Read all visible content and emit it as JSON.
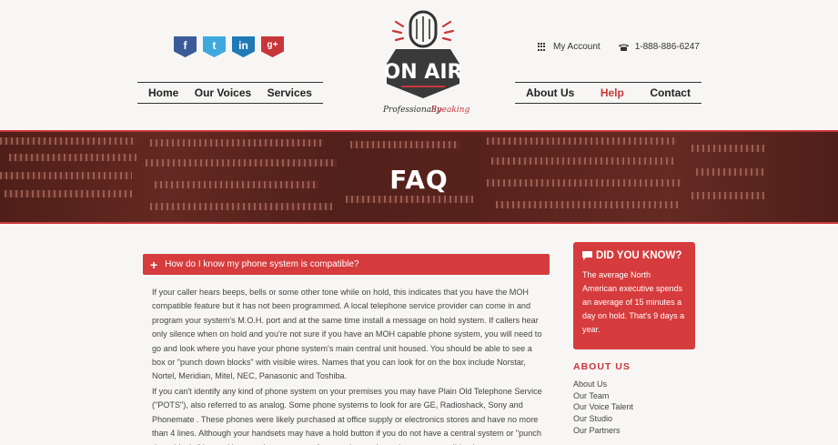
{
  "social": [
    {
      "name": "facebook",
      "glyph": "f"
    },
    {
      "name": "twitter",
      "glyph": "t"
    },
    {
      "name": "linkedin",
      "glyph": "in"
    },
    {
      "name": "google-plus",
      "glyph": "g+"
    }
  ],
  "nav_left": [
    "Home",
    "Our Voices",
    "Services"
  ],
  "nav_right": [
    "About Us",
    "Help",
    "Contact"
  ],
  "active_nav": "Help",
  "header": {
    "account_label": "My Account",
    "phone": "1-888-886-6247"
  },
  "logo": {
    "main": "ON AIR",
    "tagline_1": "Professionally",
    "tagline_2": "Speaking"
  },
  "banner": {
    "title": "FAQ"
  },
  "faq": {
    "question": "How do I know my phone system is compatible?",
    "answer_1": "If your caller hears beeps, bells or some other tone while on hold, this indicates that you have the MOH compatible feature but it has not been programmed. A local telephone service provider can come in and program your system's M.O.H. port and at the same time install a message on hold system. If callers hear only silence when on hold and you're not sure if you have an MOH capable phone system, you will need to go and look where you have your phone system's main central unit housed. You should be able to see a box or \"punch down blocks\" with visible wires. Names that you can look for on the box include Norstar, Nortel, Meridian, Mitel, NEC, Panasonic and Toshiba.",
    "answer_2": "If you can't identify any kind of phone system on your premises you may have Plain Old Telephone Service (\"POTS\"), also referred to as analog. Some phone systems to look for are GE, Radioshack, Sony and Phonemate . These phones were likely purchased at office supply or electronics stores and have no more than 4 lines. Although your handsets may have a hold button if you do not have a central system or \"punch down blocks\" located in your phone room, unfortunately you do not have a compatible phone"
  },
  "did_you_know": {
    "title": "DID YOU KNOW?",
    "text": "The average North American executive spends an average of 15 minutes a day on hold. That's 9 days a year."
  },
  "about": {
    "title": "ABOUT US",
    "links": [
      "About Us",
      "Our Team",
      "Our Voice Talent",
      "Our Studio",
      "Our Partners"
    ]
  },
  "colors": {
    "accent": "#d63c3d",
    "background": "#f7f6f4"
  }
}
